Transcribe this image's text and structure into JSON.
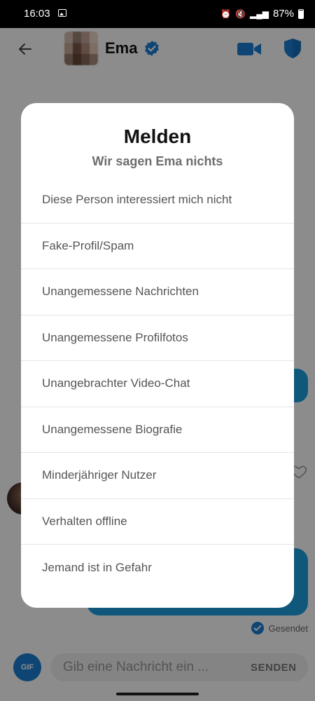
{
  "status_bar": {
    "time": "16:03",
    "battery": "87%"
  },
  "chat": {
    "contact_name": "Ema",
    "sent_status": "Gesendet",
    "composer": {
      "gif_label": "GIF",
      "placeholder": "Gib eine Nachricht ein ...",
      "send_label": "SENDEN"
    }
  },
  "colors": {
    "accent_blue": "#1b7fd3",
    "bubble_blue": "#1ea1e0"
  },
  "report_dialog": {
    "title": "Melden",
    "subtitle": "Wir sagen Ema nichts",
    "reasons": [
      {
        "label": "Diese Person interessiert mich nicht"
      },
      {
        "label": "Fake-Profil/Spam"
      },
      {
        "label": "Unangemessene Nachrichten"
      },
      {
        "label": "Unangemessene Profilfotos"
      },
      {
        "label": "Unangebrachter Video-Chat"
      },
      {
        "label": "Unangemessene Biografie"
      },
      {
        "label": "Minderjähriger Nutzer"
      },
      {
        "label": "Verhalten offline"
      },
      {
        "label": "Jemand ist in Gefahr"
      }
    ]
  }
}
